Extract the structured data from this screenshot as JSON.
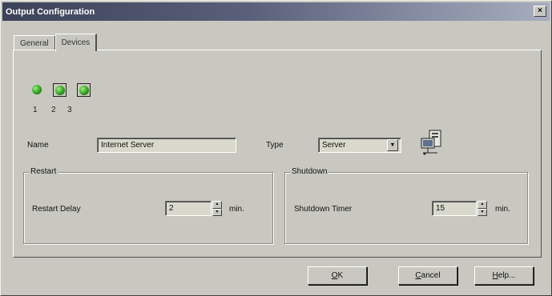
{
  "window": {
    "title": "Output Configuration",
    "close_glyph": "×"
  },
  "tabs": [
    {
      "label": "General",
      "active": false
    },
    {
      "label": "Devices",
      "active": true
    }
  ],
  "devices": [
    {
      "number": "1",
      "selected": false
    },
    {
      "number": "2",
      "selected": true
    },
    {
      "number": "3",
      "selected": true
    }
  ],
  "name_field": {
    "label": "Name",
    "value": "Internet Server"
  },
  "type_field": {
    "label": "Type",
    "value": "Server",
    "icon": "computer-network-icon"
  },
  "restart": {
    "title": "Restart",
    "label": "Restart Delay",
    "value": "2",
    "unit": "min."
  },
  "shutdown": {
    "title": "Shutdown",
    "label": "Shutdown Timer",
    "value": "15",
    "unit": "min."
  },
  "buttons": {
    "ok": {
      "mnemonic": "O",
      "rest": "K"
    },
    "cancel": {
      "mnemonic": "C",
      "rest": "ancel"
    },
    "help": {
      "mnemonic": "H",
      "rest": "elp..."
    }
  },
  "colors": {
    "titlebar_start": "#3c4258",
    "titlebar_end": "#a8aec0",
    "device_green": "#2fa01c",
    "face": "#c8c8c0"
  }
}
